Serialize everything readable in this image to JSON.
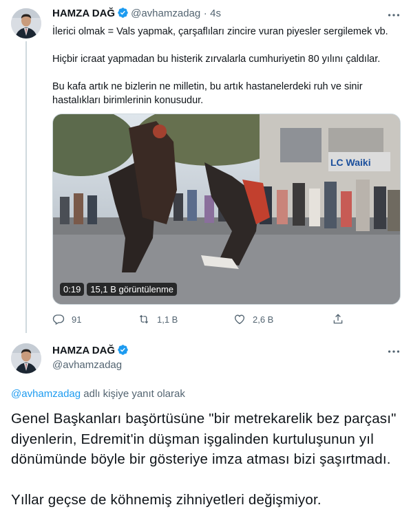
{
  "tweet": {
    "author_name": "HAMZA DAĞ",
    "author_handle": "@avhamzadag",
    "separator": "·",
    "time": "4s",
    "paragraphs": [
      "İlerici olmak = Vals yapmak, çarşaflıları zincire vuran piyesler sergilemek vb.",
      "Hiçbir icraat yapmadan bu histerik zırvalarla cumhuriyetin 80 yılını çaldılar.",
      "Bu kafa artık ne bizlerin ne milletin, bu artık hastanelerdeki ruh ve sinir hastalıkları birimlerinin konusudur."
    ],
    "video": {
      "duration": "0:19",
      "views": "15,1 B görüntülenme",
      "store_sign": "LC Waiki"
    },
    "actions": {
      "replies": "91",
      "retweets": "1,1 B",
      "likes": "2,6 B"
    }
  },
  "reply": {
    "author_name": "HAMZA DAĞ",
    "author_handle": "@avhamzadag",
    "reply_to_handle": "@avhamzadag",
    "reply_to_suffix": "adlı kişiye yanıt olarak",
    "paragraphs": [
      "Genel Başkanları başörtüsüne \"bir metrekarelik bez parçası\" diyenlerin, Edremit'in düşman işgalinden kurtuluşunun yıl dönümünde böyle bir gösteriye imza atması bizi şaşırtmadı.",
      "Yıllar geçse de köhnemiş zihniyetleri değişmiyor."
    ]
  },
  "colors": {
    "verified": "#1d9bf0",
    "link": "#1d9bf0",
    "muted": "#536471",
    "text": "#0f1419"
  },
  "icons": {
    "verified": "verified-badge-icon",
    "more": "more-dots-icon",
    "reply": "reply-bubble-icon",
    "retweet": "retweet-icon",
    "like": "heart-icon",
    "share": "share-icon"
  }
}
